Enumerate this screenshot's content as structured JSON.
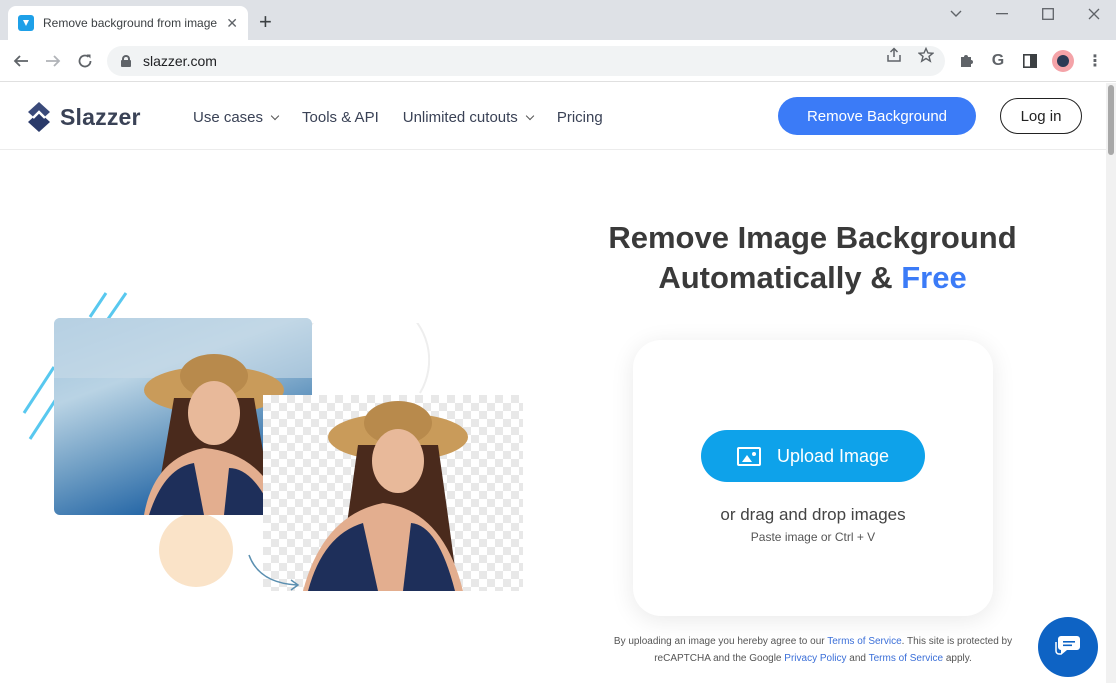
{
  "browser": {
    "tab_title": "Remove background from image",
    "url": "slazzer.com",
    "profile_initial": ""
  },
  "site": {
    "brand": "Slazzer",
    "nav": [
      {
        "label": "Use cases",
        "has_dropdown": true
      },
      {
        "label": "Tools & API",
        "has_dropdown": false
      },
      {
        "label": "Unlimited cutouts",
        "has_dropdown": true
      },
      {
        "label": "Pricing",
        "has_dropdown": false
      }
    ],
    "cta_remove": "Remove Background",
    "cta_login": "Log in"
  },
  "hero": {
    "title_line1": "Remove Image Background",
    "title_line2_prefix": "Automatically & ",
    "title_line2_accent": "Free",
    "upload_button": "Upload Image",
    "drag_text": "or drag and drop images",
    "paste_text": "Paste image or Ctrl + V"
  },
  "legal": {
    "part1": "By uploading an image you hereby agree to our ",
    "tos_link": "Terms of Service",
    "part2": ". This site is protected by reCAPTCHA and the Google ",
    "privacy_link": "Privacy Policy",
    "part3": " and ",
    "tos_link2": "Terms of Service",
    "part4": " apply."
  },
  "colors": {
    "accent_blue": "#3b7bf7",
    "upload_blue": "#0ea2ea",
    "chat_blue": "#0e63c4",
    "peach": "#fae3c8"
  },
  "icons": {
    "favicon": "slazzer-logo-icon",
    "chat": "chat-bubble-icon"
  }
}
